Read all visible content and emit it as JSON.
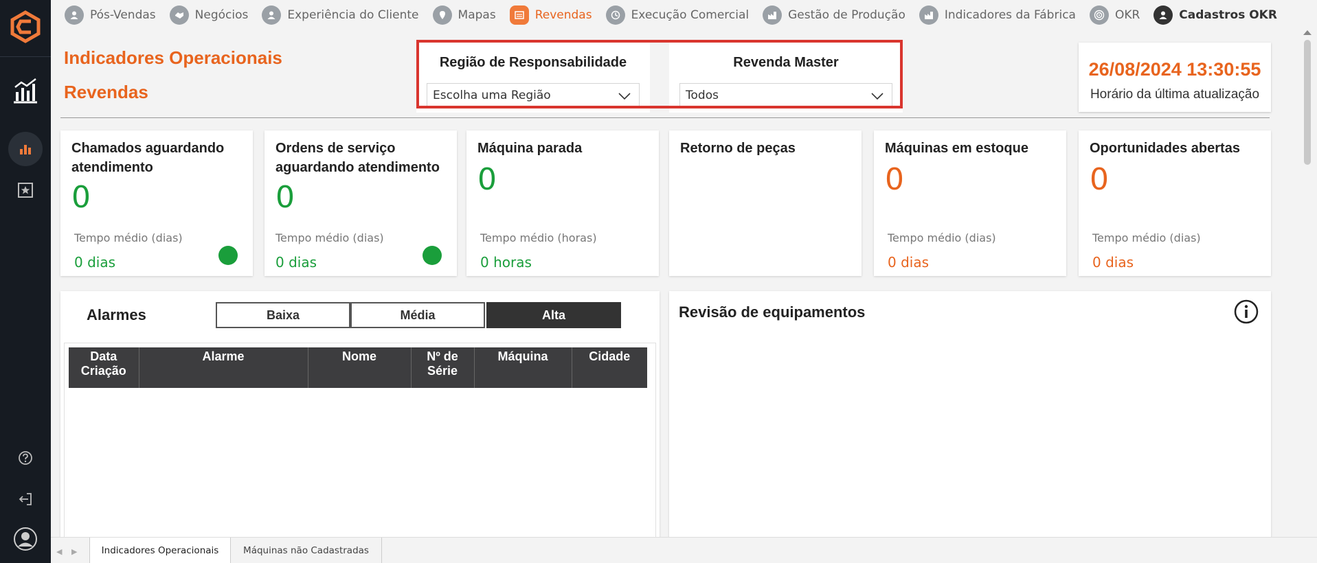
{
  "nav": {
    "items": [
      {
        "label": "Pós-Vendas",
        "state": "normal"
      },
      {
        "label": "Negócios",
        "state": "normal"
      },
      {
        "label": "Experiência do Cliente",
        "state": "normal"
      },
      {
        "label": "Mapas",
        "state": "normal"
      },
      {
        "label": "Revendas",
        "state": "active"
      },
      {
        "label": "Execução Comercial",
        "state": "normal"
      },
      {
        "label": "Gestão de Produção",
        "state": "normal"
      },
      {
        "label": "Indicadores da Fábrica",
        "state": "normal"
      },
      {
        "label": "OKR",
        "state": "normal"
      },
      {
        "label": "Cadastros OKR",
        "state": "bold"
      }
    ]
  },
  "header": {
    "title_line1": "Indicadores Operacionais",
    "title_line2": "Revendas"
  },
  "filters": {
    "regiao": {
      "label": "Região de Responsabilidade",
      "value": "Escolha uma Região"
    },
    "revenda": {
      "label": "Revenda Master",
      "value": "Todos"
    }
  },
  "last_update": {
    "value": "26/08/2024 13:30:55",
    "label": "Horário da última atualização"
  },
  "kpis": [
    {
      "title": "Chamados aguardando atendimento",
      "value": "0",
      "sub_label": "Tempo médio (dias)",
      "sub_value": "0 dias",
      "color": "green",
      "indicator": true
    },
    {
      "title": "Ordens de serviço aguardando atendimento",
      "value": "0",
      "sub_label": "Tempo médio (dias)",
      "sub_value": "0 dias",
      "color": "green",
      "indicator": true
    },
    {
      "title": "Máquina parada",
      "value": "0",
      "sub_label": "Tempo médio (horas)",
      "sub_value": "0 horas",
      "color": "green",
      "indicator": false
    },
    {
      "title": "Retorno de peças",
      "value": "",
      "sub_label": "",
      "sub_value": "",
      "color": "green",
      "indicator": false
    },
    {
      "title": "Máquinas em estoque",
      "value": "0",
      "sub_label": "Tempo médio (dias)",
      "sub_value": "0 dias",
      "color": "orange",
      "indicator": false
    },
    {
      "title": "Oportunidades abertas",
      "value": "0",
      "sub_label": "Tempo médio (dias)",
      "sub_value": "0 dias",
      "color": "orange",
      "indicator": false
    }
  ],
  "alarmes": {
    "title": "Alarmes",
    "segments": [
      "Baixa",
      "Média",
      "Alta"
    ],
    "active_segment": "Alta",
    "columns": [
      "Data Criação",
      "Alarme",
      "Nome",
      "Nº de Série",
      "Máquina",
      "Cidade"
    ]
  },
  "revisao": {
    "title": "Revisão de equipamentos"
  },
  "bottom_tabs": {
    "active": "Indicadores Operacionais",
    "inactive": "Máquinas não Cadastradas"
  },
  "colors": {
    "accent": "#e8641e",
    "green": "#1a9e3b",
    "sidebar": "#161b22",
    "highlight_border": "#d9352e"
  },
  "icons": {
    "sidebar": [
      "logo-icon",
      "dashboard-chart-icon",
      "bar-chart-icon",
      "star-icon",
      "help-icon",
      "logout-icon",
      "user-avatar-icon"
    ]
  }
}
